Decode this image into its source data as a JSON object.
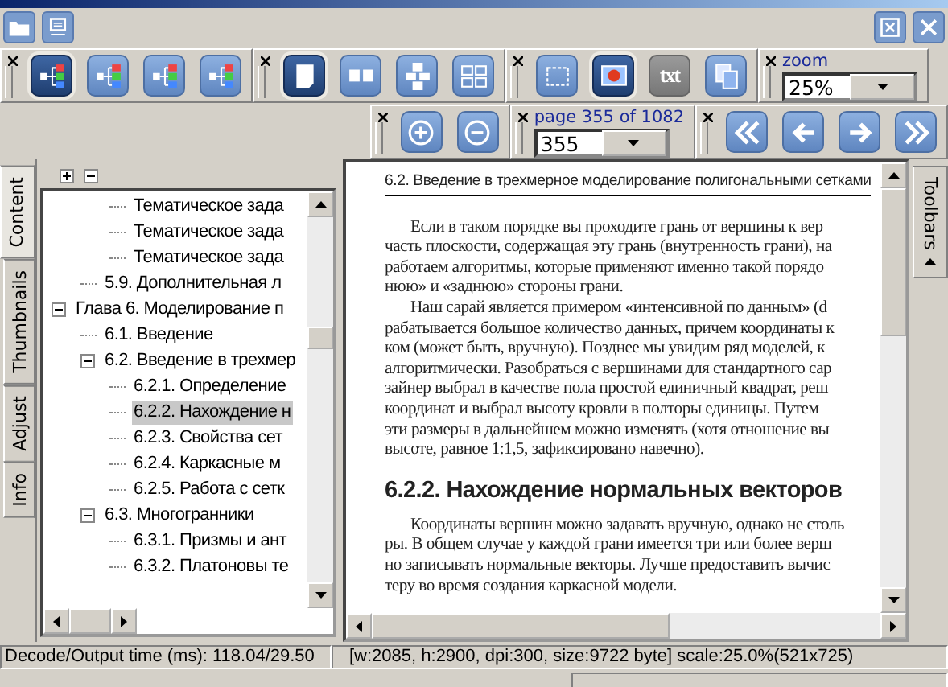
{
  "toolbar_rows": [
    [
      {
        "kind": "icons",
        "buttons": [
          {
            "kind": "tree",
            "selected": true
          },
          {
            "kind": "tree",
            "selected": false
          },
          {
            "kind": "tree",
            "selected": false
          },
          {
            "kind": "tree",
            "selected": false
          }
        ]
      },
      {
        "kind": "icons",
        "buttons": [
          {
            "kind": "page",
            "selected": true
          },
          {
            "kind": "two-pages",
            "selected": false
          },
          {
            "kind": "pages-column",
            "selected": false
          },
          {
            "kind": "grid",
            "selected": false
          }
        ]
      },
      {
        "kind": "icons",
        "buttons": [
          {
            "kind": "select",
            "selected": false
          },
          {
            "kind": "web",
            "selected": true
          },
          {
            "kind": "text",
            "label": "txt",
            "selected": false
          },
          {
            "kind": "copy",
            "selected": false
          }
        ]
      },
      {
        "kind": "combo",
        "label": "zoom",
        "value": "25%"
      }
    ],
    [
      {
        "kind": "icons",
        "buttons": [
          {
            "kind": "zoom-in"
          },
          {
            "kind": "zoom-out"
          }
        ]
      },
      {
        "kind": "combo",
        "label": "page 355 of 1082",
        "value": "355"
      },
      {
        "kind": "icons",
        "buttons": [
          {
            "kind": "first"
          },
          {
            "kind": "prev"
          },
          {
            "kind": "next"
          },
          {
            "kind": "last"
          }
        ]
      }
    ]
  ],
  "side_tabs": [
    {
      "label": "Content",
      "selected": true
    },
    {
      "label": "Thumbnails",
      "selected": false
    },
    {
      "label": "Adjust",
      "selected": false
    },
    {
      "label": "Info",
      "selected": false
    }
  ],
  "tree": [
    {
      "children": [
        {
          "children": [
            {
              "label": "Тематическое зада",
              "selected": false
            },
            {
              "label": "Тематическое зада",
              "selected": false
            },
            {
              "label": "Тематическое зада",
              "selected": false
            }
          ]
        },
        {
          "label": "5.9. Дополнительная л",
          "selected": false
        }
      ]
    },
    {
      "label": "Глава 6. Моделирование п",
      "selected": false,
      "expanded": true,
      "children": [
        {
          "label": "6.1. Введение",
          "selected": false
        },
        {
          "label": "6.2. Введение в трехмер",
          "selected": false,
          "expanded": true,
          "children": [
            {
              "label": "6.2.1. Определение",
              "selected": false
            },
            {
              "label": "6.2.2. Нахождение н",
              "selected": true
            },
            {
              "label": "6.2.3. Свойства сет",
              "selected": false
            },
            {
              "label": "6.2.4. Каркасные м",
              "selected": false
            },
            {
              "label": "6.2.5. Работа с сетк",
              "selected": false
            }
          ]
        },
        {
          "label": "6.3. Многогранники",
          "selected": false,
          "expanded": true,
          "children": [
            {
              "label": "6.3.1. Призмы и ант",
              "selected": false
            },
            {
              "label": "6.3.2. Платоновы те",
              "selected": false
            }
          ]
        }
      ]
    }
  ],
  "document": {
    "running_head": "6.2. Введение в трехмерное моделирование полигональными сетками",
    "blocks": [
      {
        "kind": "paragraph",
        "lines": [
          "Если в таком порядке вы проходите грань от вершины к вер",
          "часть плоскости, содержащая эту грань (внутренность грани), на",
          "работаем алгоритмы, которые применяют именно такой порядо",
          "нюю» и «заднюю» стороны грани."
        ]
      },
      {
        "kind": "paragraph",
        "lines": [
          "Наш сарай является примером «интенсивной по данным» (d",
          "рабатывается большое количество данных, причем координаты к",
          "ком (может быть, вручную). Позднее мы увидим ряд моделей, к",
          "алгоритмически. Разобраться с вершинами для стандартного сар",
          "зайнер выбрал в качестве пола простой единичный квадрат, реш",
          "координат и выбрал высоту кровли в полторы единицы. Путем",
          "эти размеры в дальнейшем можно изменять (хотя отношение вы",
          "высоте, равное 1:1,5, зафиксировано навечно)."
        ]
      },
      {
        "kind": "heading",
        "lines": [
          "6.2.2. Нахождение нормальных векторов"
        ]
      },
      {
        "kind": "paragraph",
        "lines": [
          "Координаты вершин можно задавать вручную, однако не столь",
          "ры. В общем случае у каждой грани имеется три или более верш",
          "но записывать нормальные векторы. Лучше предоставить вычис",
          "теру во время создания каркасной модели."
        ]
      }
    ]
  },
  "right_tab": {
    "label": "Toolbars"
  },
  "status_bar": {
    "timing": "Decode/Output time (ms): 118.04/29.50",
    "image_info": "[w:2085, h:2900, dpi:300, size:9722 byte] scale:25.0%(521x725)"
  }
}
